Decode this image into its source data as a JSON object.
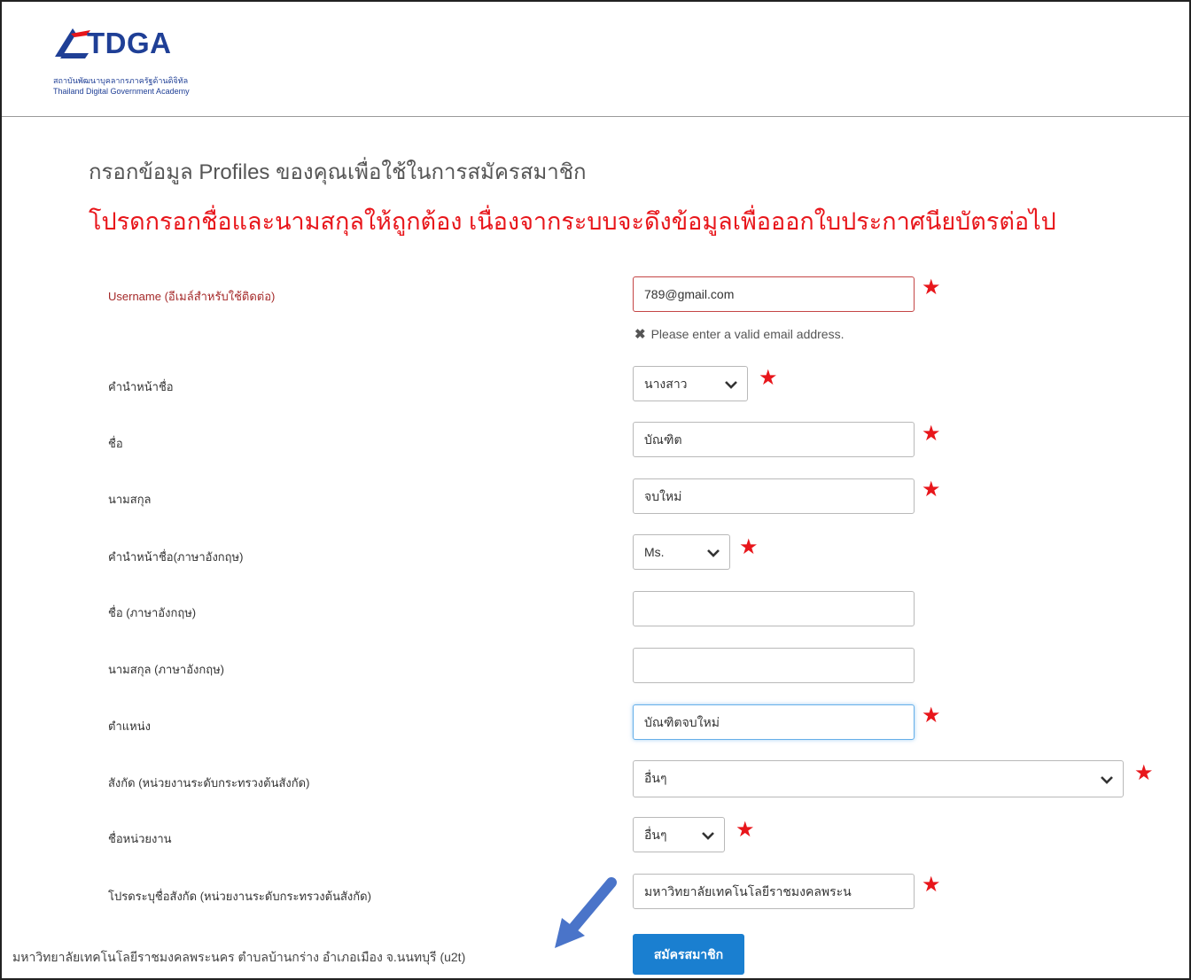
{
  "header": {
    "logo_text": "TDGA",
    "logo_sub_th": "สถาบันพัฒนาบุคลากรภาครัฐด้านดิจิทัล",
    "logo_sub_en": "Thailand Digital Government Academy"
  },
  "form": {
    "title": "กรอกข้อมูล Profiles ของคุณเพื่อใช้ในการสมัครสมาชิก",
    "warning": "โปรดกรอกชื่อและนามสกุลให้ถูกต้อง เนื่องจากระบบจะดึงข้อมูลเพื่อออกใบประกาศนียบัตรต่อไป",
    "required_mark": "★",
    "fields": {
      "username": {
        "label": "Username (อีเมล์สำหรับใช้ติดต่อ)",
        "value": "789@gmail.com",
        "error": "Please enter a valid email address.",
        "error_icon": "✖"
      },
      "title_th": {
        "label": "คำนำหน้าชื่อ",
        "value": "นางสาว"
      },
      "first_name_th": {
        "label": "ชื่อ",
        "value": "บัณฑิต"
      },
      "last_name_th": {
        "label": "นามสกุล",
        "value": "จบใหม่"
      },
      "title_en": {
        "label": "คำนำหน้าชื่อ(ภาษาอังกฤษ)",
        "value": "Ms."
      },
      "first_name_en": {
        "label": "ชื่อ (ภาษาอังกฤษ)",
        "value": ""
      },
      "last_name_en": {
        "label": "นามสกุล (ภาษาอังกฤษ)",
        "value": ""
      },
      "position": {
        "label": "ตำแหน่ง",
        "value": "บัณฑิตจบใหม่"
      },
      "affiliation": {
        "label": "สังกัด (หน่วยงานระดับกระทรวงต้นสังกัด)",
        "value": "อื่นๆ"
      },
      "unit_name": {
        "label": "ชื่อหน่วยงาน",
        "value": "อื่นๆ"
      },
      "affiliation_other": {
        "label": "โปรดระบุชื่อสังกัด (หน่วยงานระดับกระทรวงต้นสังกัด)",
        "value": "มหาวิทยาลัยเทคโนโลยีราชมงคลพระน"
      }
    },
    "submit_label": "สมัครสมาชิก"
  },
  "annotation": {
    "text": "มหาวิทยาลัยเทคโนโลยีราชมงคลพระนคร ตำบลบ้านกร่าง อำเภอเมือง จ.นนทบุรี (u2t)",
    "arrow_color": "#4a74c9"
  },
  "colors": {
    "brand": "#1f3f96",
    "required": "#e8161b",
    "button": "#1a7fd0",
    "error_border": "#c44545"
  }
}
